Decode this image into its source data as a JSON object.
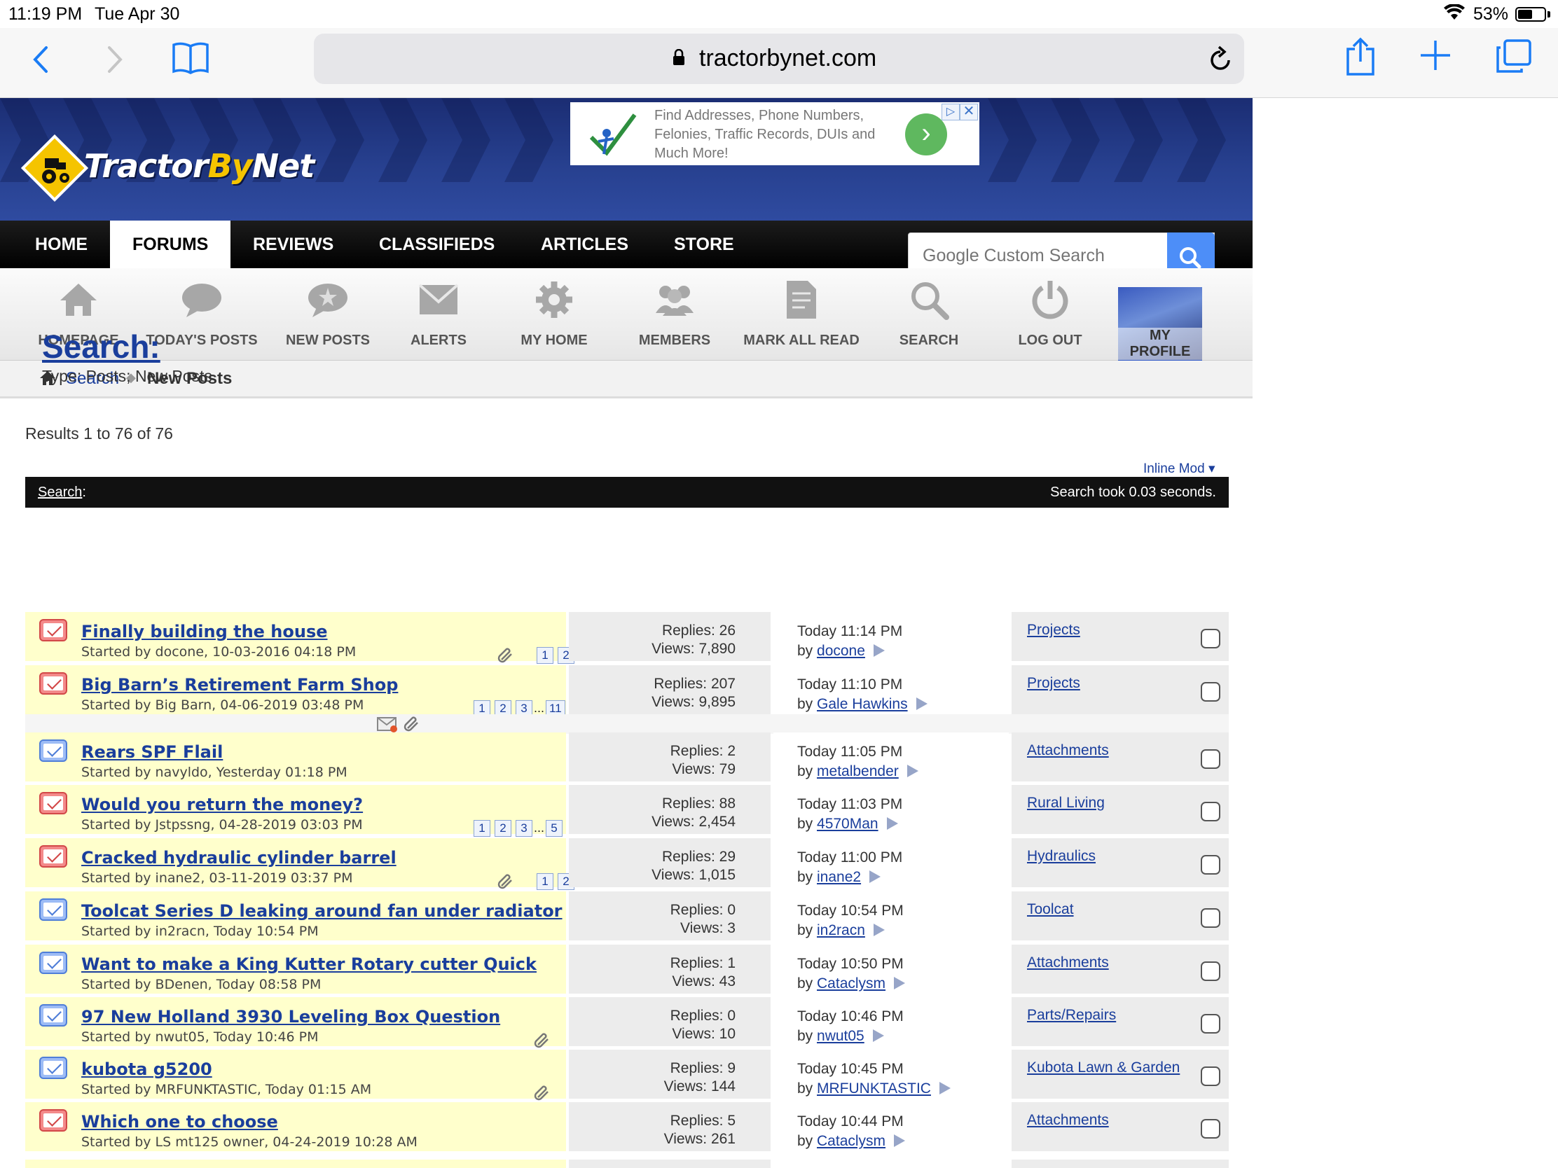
{
  "status_bar": {
    "time": "11:19 PM",
    "date": "Tue Apr 30",
    "battery": "53%"
  },
  "browser": {
    "url": "tractorbynet.com"
  },
  "site": {
    "logo_part1": "Tractor",
    "logo_part2": "By",
    "logo_part3": "Net",
    "ad": {
      "text": "Find Addresses, Phone Numbers, Felonies, Traffic Records, DUIs and Much More!"
    },
    "nav": [
      "HOME",
      "FORUMS",
      "REVIEWS",
      "CLASSIFIEDS",
      "ARTICLES",
      "STORE"
    ],
    "active_nav": "FORUMS",
    "search_placeholder": "Google Custom Search",
    "subnav": [
      "HOMEPAGE",
      "TODAY'S POSTS",
      "NEW POSTS",
      "ALERTS",
      "MY HOME",
      "MEMBERS",
      "MARK ALL READ",
      "SEARCH",
      "LOG OUT"
    ],
    "profile_label": "MY PROFILE",
    "breadcrumb": {
      "link": "Search",
      "current": "New Posts"
    }
  },
  "page": {
    "title": "Search:",
    "type": "Type: Posts; New Posts",
    "results": "Results 1 to 76 of 76",
    "inline_mod": "Inline Mod",
    "table_header_left": "Search",
    "table_header_right": "Search took 0.03 seconds."
  },
  "threads": [
    {
      "icon": "red",
      "title": "Finally building the house",
      "starter": "Started by docone, 10-03-2016 04:18 PM",
      "pages": [
        "1",
        "2"
      ],
      "attach": true,
      "replies": "Replies: 26",
      "views": "Views: 7,890",
      "last_time": "Today 11:14 PM",
      "last_by": "docone",
      "forum": "Projects"
    },
    {
      "icon": "red",
      "title": "Big Barn’s Retirement Farm Shop",
      "starter": "Started by Big Barn, 04-06-2019 03:48 PM",
      "pages": [
        "1",
        "2",
        "3",
        "...",
        "11"
      ],
      "attach": false,
      "replies": "Replies: 207",
      "views": "Views: 9,895",
      "last_time": "Today 11:10 PM",
      "last_by": "Gale Hawkins",
      "forum": "Projects"
    },
    {
      "icon": "blue",
      "title": "Rears SPF Flail",
      "starter": "Started by navyldo, Yesterday 01:18 PM",
      "pages": [],
      "attach": false,
      "replies": "Replies: 2",
      "views": "Views: 79",
      "last_time": "Today 11:05 PM",
      "last_by": "metalbender",
      "forum": "Attachments"
    },
    {
      "icon": "red",
      "title": "Would you return the money?",
      "starter": "Started by Jstpssng, 04-28-2019 03:03 PM",
      "pages": [
        "1",
        "2",
        "3",
        "...",
        "5"
      ],
      "attach": false,
      "replies": "Replies: 88",
      "views": "Views: 2,454",
      "last_time": "Today 11:03 PM",
      "last_by": "4570Man",
      "forum": "Rural Living"
    },
    {
      "icon": "red",
      "title": "Cracked hydraulic cylinder barrel",
      "starter": "Started by inane2, 03-11-2019 03:37 PM",
      "pages": [
        "1",
        "2"
      ],
      "attach": true,
      "replies": "Replies: 29",
      "views": "Views: 1,015",
      "last_time": "Today 11:00 PM",
      "last_by": "inane2",
      "forum": "Hydraulics"
    },
    {
      "icon": "blue",
      "title": "Toolcat Series D leaking around fan under radiator",
      "starter": "Started by in2racn, Today 10:54 PM",
      "pages": [],
      "attach": false,
      "replies": "Replies: 0",
      "views": "Views: 3",
      "last_time": "Today 10:54 PM",
      "last_by": "in2racn",
      "forum": "Toolcat"
    },
    {
      "icon": "blue",
      "title": "Want to make a King Kutter Rotary cutter Quick",
      "starter": "Started by BDenen, Today 08:58 PM",
      "pages": [],
      "attach": false,
      "replies": "Replies: 1",
      "views": "Views: 43",
      "last_time": "Today 10:50 PM",
      "last_by": "Cataclysm",
      "forum": "Attachments"
    },
    {
      "icon": "blue",
      "title": "97 New Holland 3930 Leveling Box Question",
      "starter": "Started by nwut05, Today 10:46 PM",
      "pages": [],
      "attach": true,
      "replies": "Replies: 0",
      "views": "Views: 10",
      "last_time": "Today 10:46 PM",
      "last_by": "nwut05",
      "forum": "Parts/Repairs"
    },
    {
      "icon": "blue",
      "title": "kubota g5200",
      "starter": "Started by MRFUNKTASTIC, Today 01:15 AM",
      "pages": [],
      "attach": true,
      "replies": "Replies: 9",
      "views": "Views: 144",
      "last_time": "Today 10:45 PM",
      "last_by": "MRFUNKTASTIC",
      "forum": "Kubota Lawn & Garden"
    },
    {
      "icon": "red",
      "title": "Which one to choose",
      "starter": "Started by LS mt125 owner, 04-24-2019 10:28 AM",
      "pages": [],
      "attach": false,
      "replies": "Replies: 5",
      "views": "Views: 261",
      "last_time": "Today 10:44 PM",
      "last_by": "Cataclysm",
      "forum": "Attachments"
    }
  ]
}
